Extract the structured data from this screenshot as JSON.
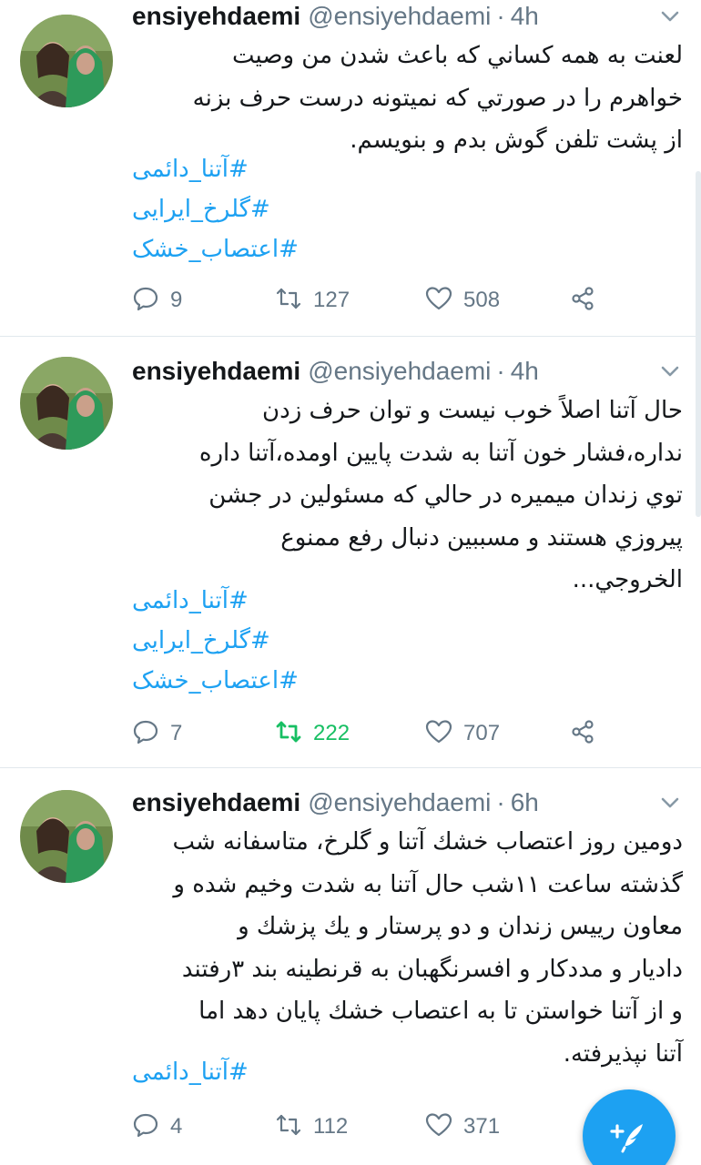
{
  "colors": {
    "accent": "#1da1f2",
    "retweet_active": "#17bf63",
    "meta_gray": "#657786",
    "text": "#14171a",
    "divider": "#e1e8ed"
  },
  "tweets": [
    {
      "name": "ensiyehdaemi",
      "handle": "@ensiyehdaemi",
      "separator": "·",
      "time": "4h",
      "lines": [
        "لعنت به همه كساني كه باعث شدن من وصيت",
        "خواهرم را در صورتي كه نميتونه درست حرف بزنه",
        "از پشت تلفن گوش بدم و بنويسم."
      ],
      "hashtags": [
        "#آتنا_دائمی",
        "#گلرخ_ایرایی",
        "#اعتصاب_خشک"
      ],
      "reply_count": "9",
      "retweet_count": "127",
      "like_count": "508",
      "retweeted": false
    },
    {
      "name": "ensiyehdaemi",
      "handle": "@ensiyehdaemi",
      "separator": "·",
      "time": "4h",
      "lines": [
        "حال آتنا اصلاً خوب نيست و توان حرف زدن",
        "نداره،فشار خون آتنا به شدت پايين اومده،آتنا داره",
        "توي زندان ميميره در حالي كه مسئولين در جشن",
        "پيروزي هستند و مسببين دنبال رفع ممنوع",
        "الخروجي..."
      ],
      "hashtags": [
        "#آتنا_دائمی",
        "#گلرخ_ایرایی",
        "#اعتصاب_خشک"
      ],
      "reply_count": "7",
      "retweet_count": "222",
      "like_count": "707",
      "retweeted": true
    },
    {
      "name": "ensiyehdaemi",
      "handle": "@ensiyehdaemi",
      "separator": "·",
      "time": "6h",
      "lines": [
        "دومين روز اعتصاب خشك آتنا و گلرخ، متاسفانه شب",
        "گذشته ساعت ۱۱شب حال آتنا به شدت وخيم شده و",
        "معاون رييس زندان و دو پرستار و يك پزشك و",
        "داديار و مددكار و افسرنگهبان به قرنطينه بند ۳رفتند",
        "و از آتنا خواستن تا به اعتصاب خشك پايان دهد اما",
        "آتنا نپذيرفته."
      ],
      "hashtags": [
        "#آتنا_دائمی"
      ],
      "reply_count": "4",
      "retweet_count": "112",
      "like_count": "371",
      "retweeted": false
    }
  ],
  "icons": {
    "reply": "reply-icon",
    "retweet": "retweet-icon",
    "like": "heart-icon",
    "share": "share-icon",
    "more": "chevron-down-icon",
    "compose": "compose-tweet-icon"
  }
}
